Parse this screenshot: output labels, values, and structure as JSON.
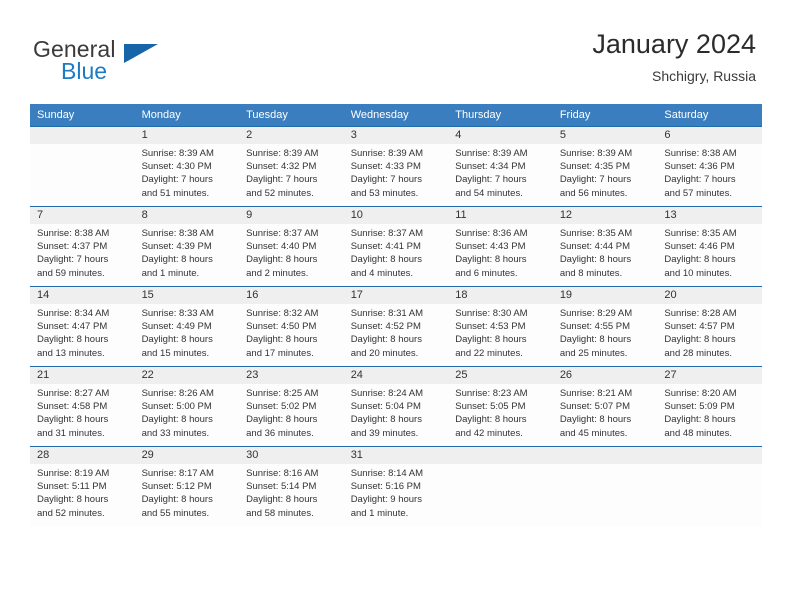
{
  "brand": {
    "word_one": "General",
    "word_two": "Blue",
    "triangle_icon": "triangle-icon",
    "accent_blue": "#1f7ac4",
    "triangle_blue": "#1565a8"
  },
  "header": {
    "title": "January 2024",
    "subtitle": "Shchigry, Russia"
  },
  "theme": {
    "header_row_bg": "#3a7ebf",
    "day_number_bg": "#efefef",
    "cell_bg": "#fdfdfd",
    "row_border": "#1f6cad",
    "text": "#333333"
  },
  "calendar": {
    "weekdays": [
      "Sunday",
      "Monday",
      "Tuesday",
      "Wednesday",
      "Thursday",
      "Friday",
      "Saturday"
    ],
    "weeks": [
      [
        {
          "empty": true,
          "day": "",
          "sunrise": "",
          "sunset": "",
          "daylight_1": "",
          "daylight_2": ""
        },
        {
          "empty": false,
          "day": "1",
          "sunrise": "Sunrise: 8:39 AM",
          "sunset": "Sunset: 4:30 PM",
          "daylight_1": "Daylight: 7 hours",
          "daylight_2": "and 51 minutes."
        },
        {
          "empty": false,
          "day": "2",
          "sunrise": "Sunrise: 8:39 AM",
          "sunset": "Sunset: 4:32 PM",
          "daylight_1": "Daylight: 7 hours",
          "daylight_2": "and 52 minutes."
        },
        {
          "empty": false,
          "day": "3",
          "sunrise": "Sunrise: 8:39 AM",
          "sunset": "Sunset: 4:33 PM",
          "daylight_1": "Daylight: 7 hours",
          "daylight_2": "and 53 minutes."
        },
        {
          "empty": false,
          "day": "4",
          "sunrise": "Sunrise: 8:39 AM",
          "sunset": "Sunset: 4:34 PM",
          "daylight_1": "Daylight: 7 hours",
          "daylight_2": "and 54 minutes."
        },
        {
          "empty": false,
          "day": "5",
          "sunrise": "Sunrise: 8:39 AM",
          "sunset": "Sunset: 4:35 PM",
          "daylight_1": "Daylight: 7 hours",
          "daylight_2": "and 56 minutes."
        },
        {
          "empty": false,
          "day": "6",
          "sunrise": "Sunrise: 8:38 AM",
          "sunset": "Sunset: 4:36 PM",
          "daylight_1": "Daylight: 7 hours",
          "daylight_2": "and 57 minutes."
        }
      ],
      [
        {
          "empty": false,
          "day": "7",
          "sunrise": "Sunrise: 8:38 AM",
          "sunset": "Sunset: 4:37 PM",
          "daylight_1": "Daylight: 7 hours",
          "daylight_2": "and 59 minutes."
        },
        {
          "empty": false,
          "day": "8",
          "sunrise": "Sunrise: 8:38 AM",
          "sunset": "Sunset: 4:39 PM",
          "daylight_1": "Daylight: 8 hours",
          "daylight_2": "and 1 minute."
        },
        {
          "empty": false,
          "day": "9",
          "sunrise": "Sunrise: 8:37 AM",
          "sunset": "Sunset: 4:40 PM",
          "daylight_1": "Daylight: 8 hours",
          "daylight_2": "and 2 minutes."
        },
        {
          "empty": false,
          "day": "10",
          "sunrise": "Sunrise: 8:37 AM",
          "sunset": "Sunset: 4:41 PM",
          "daylight_1": "Daylight: 8 hours",
          "daylight_2": "and 4 minutes."
        },
        {
          "empty": false,
          "day": "11",
          "sunrise": "Sunrise: 8:36 AM",
          "sunset": "Sunset: 4:43 PM",
          "daylight_1": "Daylight: 8 hours",
          "daylight_2": "and 6 minutes."
        },
        {
          "empty": false,
          "day": "12",
          "sunrise": "Sunrise: 8:35 AM",
          "sunset": "Sunset: 4:44 PM",
          "daylight_1": "Daylight: 8 hours",
          "daylight_2": "and 8 minutes."
        },
        {
          "empty": false,
          "day": "13",
          "sunrise": "Sunrise: 8:35 AM",
          "sunset": "Sunset: 4:46 PM",
          "daylight_1": "Daylight: 8 hours",
          "daylight_2": "and 10 minutes."
        }
      ],
      [
        {
          "empty": false,
          "day": "14",
          "sunrise": "Sunrise: 8:34 AM",
          "sunset": "Sunset: 4:47 PM",
          "daylight_1": "Daylight: 8 hours",
          "daylight_2": "and 13 minutes."
        },
        {
          "empty": false,
          "day": "15",
          "sunrise": "Sunrise: 8:33 AM",
          "sunset": "Sunset: 4:49 PM",
          "daylight_1": "Daylight: 8 hours",
          "daylight_2": "and 15 minutes."
        },
        {
          "empty": false,
          "day": "16",
          "sunrise": "Sunrise: 8:32 AM",
          "sunset": "Sunset: 4:50 PM",
          "daylight_1": "Daylight: 8 hours",
          "daylight_2": "and 17 minutes."
        },
        {
          "empty": false,
          "day": "17",
          "sunrise": "Sunrise: 8:31 AM",
          "sunset": "Sunset: 4:52 PM",
          "daylight_1": "Daylight: 8 hours",
          "daylight_2": "and 20 minutes."
        },
        {
          "empty": false,
          "day": "18",
          "sunrise": "Sunrise: 8:30 AM",
          "sunset": "Sunset: 4:53 PM",
          "daylight_1": "Daylight: 8 hours",
          "daylight_2": "and 22 minutes."
        },
        {
          "empty": false,
          "day": "19",
          "sunrise": "Sunrise: 8:29 AM",
          "sunset": "Sunset: 4:55 PM",
          "daylight_1": "Daylight: 8 hours",
          "daylight_2": "and 25 minutes."
        },
        {
          "empty": false,
          "day": "20",
          "sunrise": "Sunrise: 8:28 AM",
          "sunset": "Sunset: 4:57 PM",
          "daylight_1": "Daylight: 8 hours",
          "daylight_2": "and 28 minutes."
        }
      ],
      [
        {
          "empty": false,
          "day": "21",
          "sunrise": "Sunrise: 8:27 AM",
          "sunset": "Sunset: 4:58 PM",
          "daylight_1": "Daylight: 8 hours",
          "daylight_2": "and 31 minutes."
        },
        {
          "empty": false,
          "day": "22",
          "sunrise": "Sunrise: 8:26 AM",
          "sunset": "Sunset: 5:00 PM",
          "daylight_1": "Daylight: 8 hours",
          "daylight_2": "and 33 minutes."
        },
        {
          "empty": false,
          "day": "23",
          "sunrise": "Sunrise: 8:25 AM",
          "sunset": "Sunset: 5:02 PM",
          "daylight_1": "Daylight: 8 hours",
          "daylight_2": "and 36 minutes."
        },
        {
          "empty": false,
          "day": "24",
          "sunrise": "Sunrise: 8:24 AM",
          "sunset": "Sunset: 5:04 PM",
          "daylight_1": "Daylight: 8 hours",
          "daylight_2": "and 39 minutes."
        },
        {
          "empty": false,
          "day": "25",
          "sunrise": "Sunrise: 8:23 AM",
          "sunset": "Sunset: 5:05 PM",
          "daylight_1": "Daylight: 8 hours",
          "daylight_2": "and 42 minutes."
        },
        {
          "empty": false,
          "day": "26",
          "sunrise": "Sunrise: 8:21 AM",
          "sunset": "Sunset: 5:07 PM",
          "daylight_1": "Daylight: 8 hours",
          "daylight_2": "and 45 minutes."
        },
        {
          "empty": false,
          "day": "27",
          "sunrise": "Sunrise: 8:20 AM",
          "sunset": "Sunset: 5:09 PM",
          "daylight_1": "Daylight: 8 hours",
          "daylight_2": "and 48 minutes."
        }
      ],
      [
        {
          "empty": false,
          "day": "28",
          "sunrise": "Sunrise: 8:19 AM",
          "sunset": "Sunset: 5:11 PM",
          "daylight_1": "Daylight: 8 hours",
          "daylight_2": "and 52 minutes."
        },
        {
          "empty": false,
          "day": "29",
          "sunrise": "Sunrise: 8:17 AM",
          "sunset": "Sunset: 5:12 PM",
          "daylight_1": "Daylight: 8 hours",
          "daylight_2": "and 55 minutes."
        },
        {
          "empty": false,
          "day": "30",
          "sunrise": "Sunrise: 8:16 AM",
          "sunset": "Sunset: 5:14 PM",
          "daylight_1": "Daylight: 8 hours",
          "daylight_2": "and 58 minutes."
        },
        {
          "empty": false,
          "day": "31",
          "sunrise": "Sunrise: 8:14 AM",
          "sunset": "Sunset: 5:16 PM",
          "daylight_1": "Daylight: 9 hours",
          "daylight_2": "and 1 minute."
        },
        {
          "empty": true,
          "day": "",
          "sunrise": "",
          "sunset": "",
          "daylight_1": "",
          "daylight_2": ""
        },
        {
          "empty": true,
          "day": "",
          "sunrise": "",
          "sunset": "",
          "daylight_1": "",
          "daylight_2": ""
        },
        {
          "empty": true,
          "day": "",
          "sunrise": "",
          "sunset": "",
          "daylight_1": "",
          "daylight_2": ""
        }
      ]
    ]
  }
}
